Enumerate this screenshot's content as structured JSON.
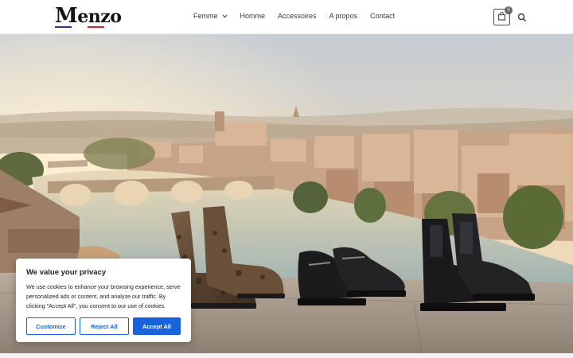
{
  "header": {
    "logo": {
      "initial": "M",
      "rest": "enzo",
      "flag_colors": [
        "#1f3c88",
        "#ffffff",
        "#d22630"
      ]
    },
    "nav": [
      {
        "label": "Femme",
        "has_dropdown": true
      },
      {
        "label": "Homme"
      },
      {
        "label": "Accessoires"
      },
      {
        "label": "A propos"
      },
      {
        "label": "Contact"
      }
    ],
    "cart_count": "0",
    "icons": {
      "cart": "shopping-bag-icon",
      "search": "search-icon",
      "dropdown": "chevron-down-icon"
    }
  },
  "hero": {
    "description_colors": {
      "sky_top": "#c9cfd6",
      "sky_glow": "#f4d9ae",
      "river": "#b7c9c9",
      "stone": "#a99c8f"
    }
  },
  "cookie_banner": {
    "title": "We value your privacy",
    "text": "We use cookies to enhance your browsing experience, serve personalized ads or content, and analyze our traffic. By clicking \"Accept All\", you consent to our use of cookies.",
    "customize_label": "Customize",
    "reject_label": "Reject All",
    "accept_label": "Accept All",
    "accent_color": "#1863dc"
  }
}
